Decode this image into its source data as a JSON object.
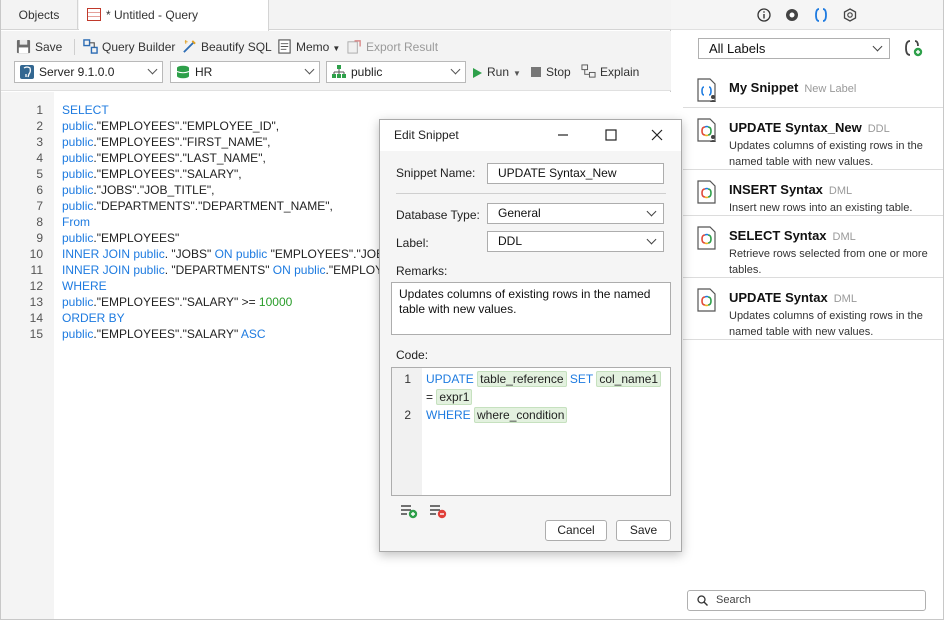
{
  "tabs": {
    "objects": "Objects",
    "query": "* Untitled - Query"
  },
  "toolbar": {
    "save": "Save",
    "query_builder": "Query Builder",
    "beautify": "Beautify SQL",
    "memo": "Memo",
    "export": "Export Result",
    "server": "Server 9.1.0.0",
    "database": "HR",
    "schema": "public",
    "run": "Run",
    "stop": "Stop",
    "explain": "Explain"
  },
  "editor": {
    "lines": [
      {
        "n": "1",
        "parts": [
          {
            "t": "SELECT",
            "c": "kw"
          }
        ]
      },
      {
        "n": "2",
        "parts": [
          {
            "t": "public",
            "c": "kw"
          },
          {
            "t": ".\"EMPLOYEES\".\"EMPLOYEE_ID\",",
            "c": ""
          }
        ]
      },
      {
        "n": "3",
        "parts": [
          {
            "t": "public",
            "c": "kw"
          },
          {
            "t": ".\"EMPLOYEES\".\"FIRST_NAME\",",
            "c": ""
          }
        ]
      },
      {
        "n": "4",
        "parts": [
          {
            "t": "public",
            "c": "kw"
          },
          {
            "t": ".\"EMPLOYEES\".\"LAST_NAME\",",
            "c": ""
          }
        ]
      },
      {
        "n": "5",
        "parts": [
          {
            "t": "public",
            "c": "kw"
          },
          {
            "t": ".\"EMPLOYEES\".\"SALARY\",",
            "c": ""
          }
        ]
      },
      {
        "n": "6",
        "parts": [
          {
            "t": "public",
            "c": "kw"
          },
          {
            "t": ".\"JOBS\".\"JOB_TITLE\",",
            "c": ""
          }
        ]
      },
      {
        "n": "7",
        "parts": [
          {
            "t": "public",
            "c": "kw"
          },
          {
            "t": ".\"DEPARTMENTS\".\"DEPARTMENT_NAME\",",
            "c": ""
          }
        ]
      },
      {
        "n": "8",
        "parts": [
          {
            "t": "From",
            "c": "kw"
          }
        ]
      },
      {
        "n": "9",
        "parts": [
          {
            "t": "public",
            "c": "kw"
          },
          {
            "t": ".\"EMPLOYEES\"",
            "c": ""
          }
        ]
      },
      {
        "n": "10",
        "parts": [
          {
            "t": "INNER JOIN public",
            "c": "kw"
          },
          {
            "t": ". \"JOBS\" ",
            "c": ""
          },
          {
            "t": "ON public",
            "c": "kw"
          },
          {
            "t": " \"EMPLOYEES\".\"JOB_ID",
            "c": ""
          }
        ]
      },
      {
        "n": "11",
        "parts": [
          {
            "t": "INNER JOIN public",
            "c": "kw"
          },
          {
            "t": ". \"DEPARTMENTS\" ",
            "c": ""
          },
          {
            "t": "ON public",
            "c": "kw"
          },
          {
            "t": ".\"EMPLOYE",
            "c": ""
          }
        ]
      },
      {
        "n": "12",
        "parts": [
          {
            "t": "WHERE",
            "c": "kw"
          }
        ]
      },
      {
        "n": "13",
        "parts": [
          {
            "t": "public",
            "c": "kw"
          },
          {
            "t": ".\"EMPLOYEES\".\"SALARY\" >= ",
            "c": ""
          },
          {
            "t": "10000",
            "c": "num"
          }
        ]
      },
      {
        "n": "14",
        "parts": [
          {
            "t": "ORDER BY",
            "c": "kw"
          }
        ]
      },
      {
        "n": "15",
        "parts": [
          {
            "t": "public",
            "c": "kw"
          },
          {
            "t": ".\"EMPLOYEES\".\"SALARY\" ",
            "c": ""
          },
          {
            "t": "ASC",
            "c": "kw"
          }
        ]
      }
    ]
  },
  "dialog": {
    "title": "Edit Snippet",
    "snippet_name_label": "Snippet Name:",
    "snippet_name_value": "UPDATE Syntax_New",
    "db_type_label": "Database Type:",
    "db_type_value": "General",
    "label_label": "Label:",
    "label_value": "DDL",
    "remarks_label": "Remarks:",
    "remarks_value": "Updates columns of existing rows in the named table with new values.",
    "code_label": "Code:",
    "code": {
      "line1_n": "1",
      "kw_update": "UPDATE",
      "ph_table": "table_reference",
      "kw_set": "SET",
      "ph_col": "col_name1",
      "eq": "=",
      "ph_expr": "expr1",
      "line2_n": "2",
      "kw_where": "WHERE",
      "ph_cond": "where_condition"
    },
    "cancel": "Cancel",
    "save": "Save"
  },
  "right": {
    "label_filter": "All Labels",
    "search_placeholder": "Search",
    "snippets": [
      {
        "name": "My Snippet",
        "label": "New Label",
        "desc": ""
      },
      {
        "name": "UPDATE Syntax_New",
        "label": "DDL",
        "desc": "Updates columns of existing rows in the named table with new values."
      },
      {
        "name": "INSERT Syntax",
        "label": "DML",
        "desc": "Insert new rows into an existing table."
      },
      {
        "name": "SELECT Syntax",
        "label": "DML",
        "desc": "Retrieve rows selected from one or more tables."
      },
      {
        "name": "UPDATE Syntax",
        "label": "DML",
        "desc": "Updates columns of existing rows in the named table with new values."
      }
    ]
  },
  "colors": {
    "keyword": "#1e7be0",
    "number": "#2a9d2a",
    "placeholder_bg": "#e3f1df"
  }
}
